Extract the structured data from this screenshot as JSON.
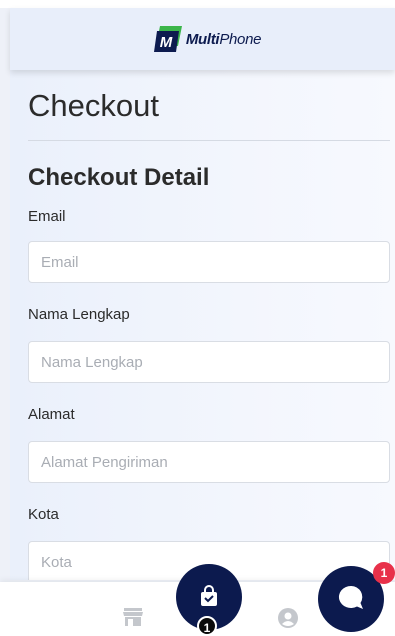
{
  "header": {
    "logo_mark": "M",
    "logo_bold": "Multi",
    "logo_light": "Phone",
    "logo_icon": "multiphone-logo-icon"
  },
  "page": {
    "title": "Checkout",
    "section_title": "Checkout Detail"
  },
  "form": {
    "email": {
      "label": "Email",
      "placeholder": "Email",
      "value": ""
    },
    "full_name": {
      "label": "Nama Lengkap",
      "placeholder": "Nama Lengkap",
      "value": ""
    },
    "address": {
      "label": "Alamat",
      "placeholder": "Alamat Pengiriman",
      "value": ""
    },
    "city": {
      "label": "Kota",
      "placeholder": "Kota",
      "value": ""
    }
  },
  "bottom_nav": {
    "store_icon": "store-icon",
    "cart_icon": "shopping-bag-icon",
    "cart_count": "1",
    "user_icon": "user-icon"
  },
  "chat": {
    "icon": "chat-bubble-icon",
    "unread_count": "1"
  },
  "colors": {
    "brand_navy": "#0c1a4e",
    "brand_green": "#3bb54a",
    "badge_red": "#e8314a",
    "background": "#eef1f8"
  }
}
